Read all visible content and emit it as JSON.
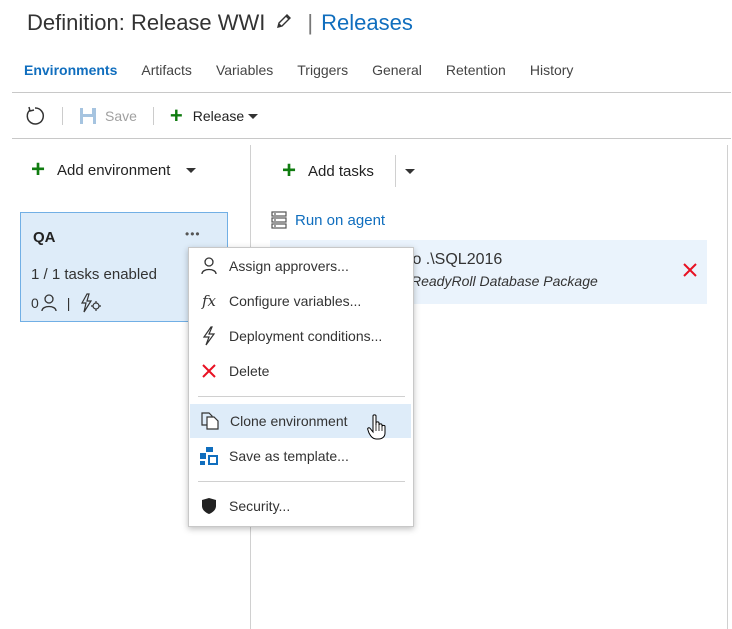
{
  "header": {
    "title": "Definition: Release WWI",
    "separator": "|",
    "link": "Releases"
  },
  "tabs": [
    {
      "label": "Environments",
      "active": true
    },
    {
      "label": "Artifacts",
      "active": false
    },
    {
      "label": "Variables",
      "active": false
    },
    {
      "label": "Triggers",
      "active": false
    },
    {
      "label": "General",
      "active": false
    },
    {
      "label": "Retention",
      "active": false
    },
    {
      "label": "History",
      "active": false
    }
  ],
  "toolbar": {
    "save_label": "Save",
    "release_label": "Release"
  },
  "left_panel": {
    "add_environment_label": "Add environment"
  },
  "environment": {
    "name": "QA",
    "tasks_enabled": "1 / 1 tasks enabled",
    "approvers_count": "0",
    "footer_sep": "|",
    "menu_dots": "•••"
  },
  "right_panel": {
    "add_tasks_label": "Add tasks",
    "run_on_agent_label": "Run on agent",
    "task_title_partial": "to .\\SQL2016",
    "task_subtitle_partial": "ReadyRoll Database Package"
  },
  "context_menu": {
    "items": [
      {
        "label": "Assign approvers...",
        "icon": "person-icon"
      },
      {
        "label": "Configure variables...",
        "icon": "fx-icon"
      },
      {
        "label": "Deployment conditions...",
        "icon": "lightning-icon"
      },
      {
        "label": "Delete",
        "icon": "delete-x-icon"
      },
      {
        "label": "Clone environment",
        "icon": "clone-icon",
        "hover": true
      },
      {
        "label": "Save as template...",
        "icon": "template-icon"
      },
      {
        "label": "Security...",
        "icon": "shield-icon"
      }
    ]
  },
  "colors": {
    "accent": "#106ebe",
    "add_green": "#107c10",
    "delete_red": "#e81123",
    "env_card_bg": "#deecf9",
    "task_row_bg": "#eaf3fc"
  }
}
